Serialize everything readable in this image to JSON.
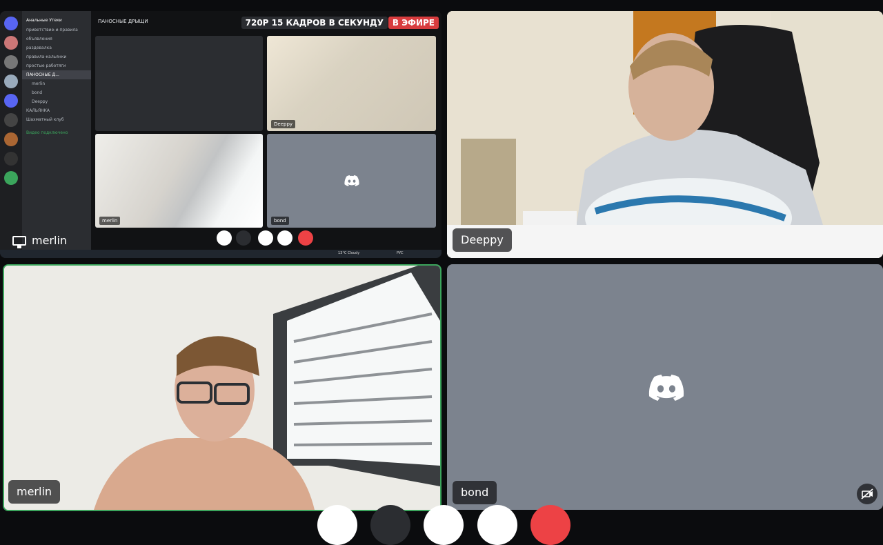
{
  "share": {
    "label": "merlin",
    "channel": "ПАНОСНЫЕ ДРЫЩИ",
    "quality": "720P 15 КАДРОВ В СЕКУНДУ",
    "live_badge": "В ЭФИРЕ",
    "server_name": "Анальные Утеки",
    "channel_list": [
      "приветствие-и-правила",
      "объявления",
      "раздевалка",
      "правила-кальянки",
      "простые работяги",
      "ПАНОСНЫЕ Д...",
      "КАЛЬЯНКА",
      "Шахматный клуб"
    ],
    "voice_members": [
      "merlin",
      "bond",
      "Deeppy"
    ],
    "mini_tiles": [
      "Deeppy",
      "merlin",
      "bond"
    ],
    "status_text": "Видео подключено",
    "weather": "13°C Cloudy",
    "tray": "РУС"
  },
  "tiles": {
    "deeppy": {
      "name": "Deeppy"
    },
    "merlin": {
      "name": "merlin"
    },
    "bond": {
      "name": "bond"
    }
  },
  "colors": {
    "speaking_border": "#3ba55c",
    "live_red": "#d83c3e",
    "tile_gray": "#7c838e",
    "hangup": "#ed4245"
  }
}
